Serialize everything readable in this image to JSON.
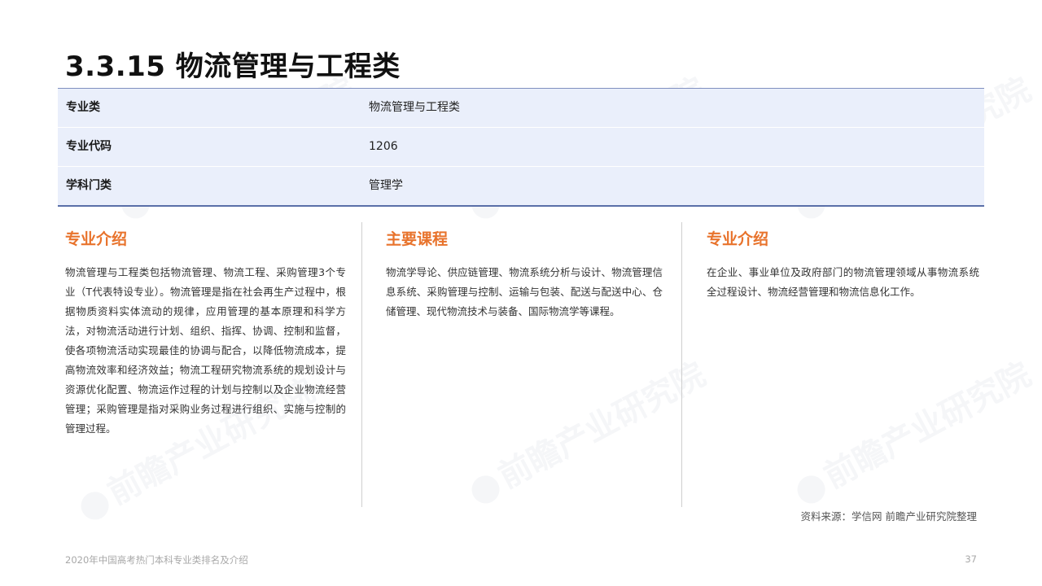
{
  "page": {
    "title": "3.3.15 物流管理与工程类"
  },
  "info_table": {
    "rows": [
      {
        "label": "专业类",
        "value": "物流管理与工程类"
      },
      {
        "label": "专业代码",
        "value": "1206"
      },
      {
        "label": "学科门类",
        "value": "管理学"
      }
    ]
  },
  "columns": [
    {
      "heading": "专业介绍",
      "body": "物流管理与工程类包括物流管理、物流工程、采购管理3个专业（T代表特设专业）。物流管理是指在社会再生产过程中，根据物质资料实体流动的规律，应用管理的基本原理和科学方法，对物流活动进行计划、组织、指挥、协调、控制和监督，使各项物流活动实现最佳的协调与配合，以降低物流成本，提高物流效率和经济效益；物流工程研究物流系统的规划设计与资源优化配置、物流运作过程的计划与控制以及企业物流经营管理；采购管理是指对采购业务过程进行组织、实施与控制的管理过程。"
    },
    {
      "heading": "主要课程",
      "body": "物流学导论、供应链管理、物流系统分析与设计、物流管理信息系统、采购管理与控制、运输与包装、配送与配送中心、仓储管理、现代物流技术与装备、国际物流学等课程。"
    },
    {
      "heading": "专业介绍",
      "body": "在企业、事业单位及政府部门的物流管理领域从事物流系统全过程设计、物流经营管理和物流信息化工作。"
    }
  ],
  "source_note": "资料来源：学信网 前瞻产业研究院整理",
  "footer": {
    "text": "2020年中国高考热门本科专业类排名及介绍",
    "page_number": "37"
  },
  "watermark": {
    "text": "前瞻产业研究院"
  }
}
